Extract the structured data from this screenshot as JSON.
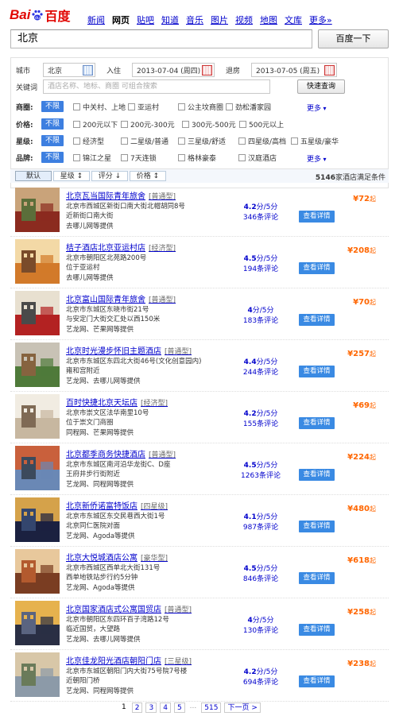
{
  "logo": {
    "text_bai": "Bai",
    "text_du": "百度"
  },
  "nav": [
    "新闻",
    "网页",
    "贴吧",
    "知道",
    "音乐",
    "图片",
    "视频",
    "地图",
    "文库",
    "更多»"
  ],
  "nav_current": 1,
  "search": {
    "query": "北京",
    "button": "百度一下"
  },
  "filter": {
    "city_label": "城市",
    "city_value": "北京",
    "checkin_label": "入住",
    "checkin_value": "2013-07-04 (周四)",
    "checkout_label": "退房",
    "checkout_value": "2013-07-05 (周五)",
    "keyword_label": "关键词",
    "keyword_placeholder": "酒店名称、地标、商圈  可组合搜索",
    "query_button": "快速查询",
    "unlimited": "不限",
    "more": "更多",
    "rows": [
      {
        "label": "商圈:",
        "options": [
          "中关村、上地",
          "亚运村",
          "公主坟商圈",
          "劲松潘家园"
        ],
        "more": true
      },
      {
        "label": "价格:",
        "options": [
          "200元以下",
          "200元-300元",
          "300元-500元",
          "500元以上"
        ],
        "more": false
      },
      {
        "label": "星级:",
        "options": [
          "经济型",
          "二星级/普通",
          "三星级/舒适",
          "四星级/高档",
          "五星级/豪华"
        ],
        "more": false
      },
      {
        "label": "品牌:",
        "options": [
          "锦江之星",
          "7天连锁",
          "格林豪泰",
          "汉庭酒店"
        ],
        "more": true
      }
    ]
  },
  "sort": {
    "tabs": [
      "默认",
      "星级 ↕",
      "评分 ↓",
      "价格 ↕"
    ],
    "total": "5146",
    "total_suffix": "家酒店满足条件"
  },
  "hotels": [
    {
      "name": "北京瓦当国际青年旅舍",
      "type": "[普通型]",
      "addr": "北京市西城区新街口南大街北帽胡同8号",
      "near": "近新街口南大街",
      "source": "去哪儿网等提供",
      "score": "4.2",
      "score_unit": "分/5分",
      "reviews": "346条评论",
      "price": "¥72",
      "price_suffix": "起",
      "button": "查看详情"
    },
    {
      "name": "桔子酒店北京亚运村店",
      "type": "[经济型]",
      "addr": "北京市朝阳区北苑路200号",
      "near": "位于亚运村",
      "source": "去哪儿网等提供",
      "score": "4.5",
      "score_unit": "分/5分",
      "reviews": "194条评论",
      "price": "¥208",
      "price_suffix": "起",
      "button": "查看详情"
    },
    {
      "name": "北京富山国际青年旅舍",
      "type": "[普通型]",
      "addr": "北京市东城区东晓市街21号",
      "near": "与安定门大街交汇处以西150米",
      "source": "艺龙网、芒果网等提供",
      "score": "4",
      "score_unit": "分/5分",
      "reviews": "183条评论",
      "price": "¥70",
      "price_suffix": "起",
      "button": "查看详情"
    },
    {
      "name": "北京时光漫步怀旧主题酒店",
      "type": "[普通型]",
      "addr": "北京市东城区东四北大街46号(文化创意园内)",
      "near": "雍和宫附近",
      "source": "艺龙网、去哪儿网等提供",
      "score": "4.4",
      "score_unit": "分/5分",
      "reviews": "244条评论",
      "price": "¥257",
      "price_suffix": "起",
      "button": "查看详情"
    },
    {
      "name": "百时快捷北京天坛店",
      "type": "[经济型]",
      "addr": "北京市崇文区法华南里10号",
      "near": "位于崇文门商圈",
      "source": "同程网、芒果网等提供",
      "score": "4.2",
      "score_unit": "分/5分",
      "reviews": "155条评论",
      "price": "¥69",
      "price_suffix": "起",
      "button": "查看详情"
    },
    {
      "name": "北京都季商务快捷酒店",
      "type": "[普通型]",
      "addr": "北京市东城区南河沿华龙街C、D座",
      "near": "王府井步行街附近",
      "source": "艺龙网、同程网等提供",
      "score": "4.5",
      "score_unit": "分/5分",
      "reviews": "1263条评论",
      "price": "¥224",
      "price_suffix": "起",
      "button": "查看详情"
    },
    {
      "name": "北京新侨诺富特饭店",
      "type": "[四星级]",
      "addr": "北京市东城区东交民巷西大街1号",
      "near": "北京同仁医院对面",
      "source": "艺龙网、Agoda等提供",
      "score": "4.1",
      "score_unit": "分/5分",
      "reviews": "987条评论",
      "price": "¥480",
      "price_suffix": "起",
      "button": "查看详情"
    },
    {
      "name": "北京大悦城酒店公寓",
      "type": "[豪华型]",
      "addr": "北京市西城区西单北大街131号",
      "near": "西单地铁站步行约5分钟",
      "source": "艺龙网、Agoda等提供",
      "score": "4.5",
      "score_unit": "分/5分",
      "reviews": "846条评论",
      "price": "¥618",
      "price_suffix": "起",
      "button": "查看详情"
    },
    {
      "name": "北京国家酒店式公寓国贸店",
      "type": "[普通型]",
      "addr": "北京市朝阳区东四环百子湾路12号",
      "near": "临近国贸，大望路",
      "source": "艺龙网、去哪儿网等提供",
      "score": "4",
      "score_unit": "分/5分",
      "reviews": "130条评论",
      "price": "¥258",
      "price_suffix": "起",
      "button": "查看详情"
    },
    {
      "name": "北京佳龙阳光酒店朝阳门店",
      "type": "[三星级]",
      "addr": "北京市东城区朝阳门内大街75号院7号楼",
      "near": "近朝阳门桥",
      "source": "艺龙网、同程网等提供",
      "score": "4.2",
      "score_unit": "分/5分",
      "reviews": "694条评论",
      "price": "¥238",
      "price_suffix": "起",
      "button": "查看详情"
    }
  ],
  "pager": {
    "pages": [
      "1",
      "2",
      "3",
      "4",
      "5"
    ],
    "dots": "...",
    "last": "515",
    "next": "下一页 >"
  }
}
